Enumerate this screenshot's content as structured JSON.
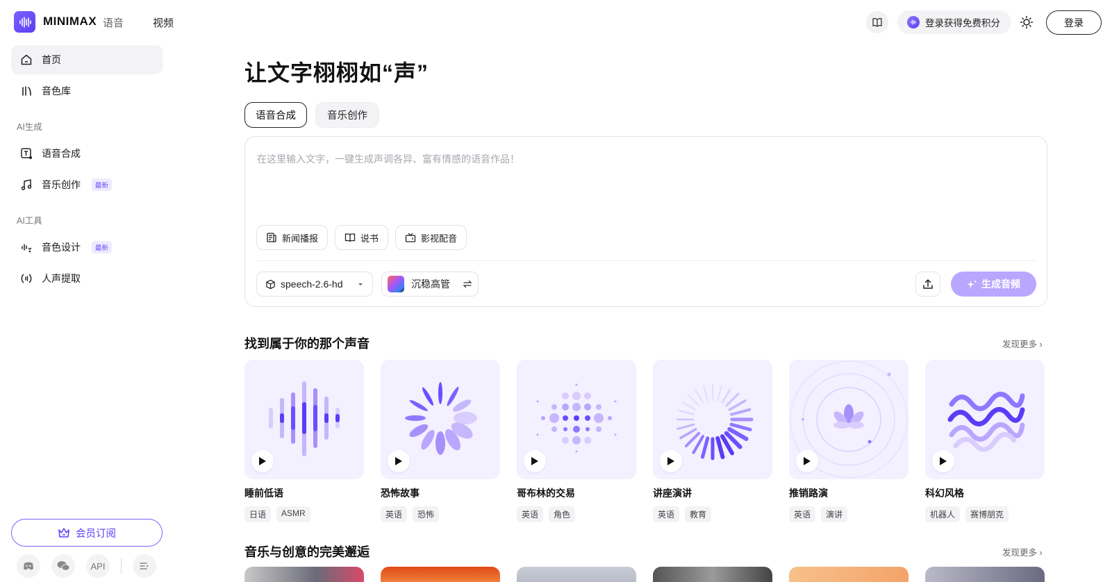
{
  "header": {
    "brand": "MINIMAX",
    "brand_sub": "语音",
    "nav_video": "视频",
    "credits_label": "登录获得免费积分",
    "login_label": "登录"
  },
  "sidebar": {
    "home": "首页",
    "voice_library": "音色库",
    "section_ai_gen": "AI生成",
    "speech_synthesis": "语音合成",
    "music_creation": "音乐创作",
    "new_badge": "最新",
    "section_ai_tools": "AI工具",
    "voice_design": "音色设计",
    "vocal_extract": "人声提取",
    "member_label": "会员订阅",
    "api_label": "API"
  },
  "main": {
    "title": "让文字栩栩如“声”",
    "tabs": [
      "语音合成",
      "音乐创作"
    ],
    "placeholder": "在这里输入文字，一键生成声调各异、富有情感的语音作品！",
    "chips": [
      "新闻播报",
      "说书",
      "影视配音"
    ],
    "model": "speech-2.6-hd",
    "voice": "沉稳高管",
    "generate_label": "生成音频",
    "section1_title": "找到属于你的那个声音",
    "section2_title": "音乐与创意的完美邂逅",
    "more_label": "发现更多 ›"
  },
  "voices": [
    {
      "name": "睡前低语",
      "tags": [
        "日语",
        "ASMR"
      ]
    },
    {
      "name": "恐怖故事",
      "tags": [
        "英语",
        "恐怖"
      ]
    },
    {
      "name": "哥布林的交易",
      "tags": [
        "英语",
        "角色"
      ]
    },
    {
      "name": "讲座演讲",
      "tags": [
        "英语",
        "教育"
      ]
    },
    {
      "name": "推销路演",
      "tags": [
        "英语",
        "演讲"
      ]
    },
    {
      "name": "科幻风格",
      "tags": [
        "机器人",
        "赛博朋克"
      ]
    }
  ],
  "colors": {
    "accent": "#5b3df5",
    "accent_light": "#b8a6ff",
    "card_bg": "#f3f0ff"
  }
}
